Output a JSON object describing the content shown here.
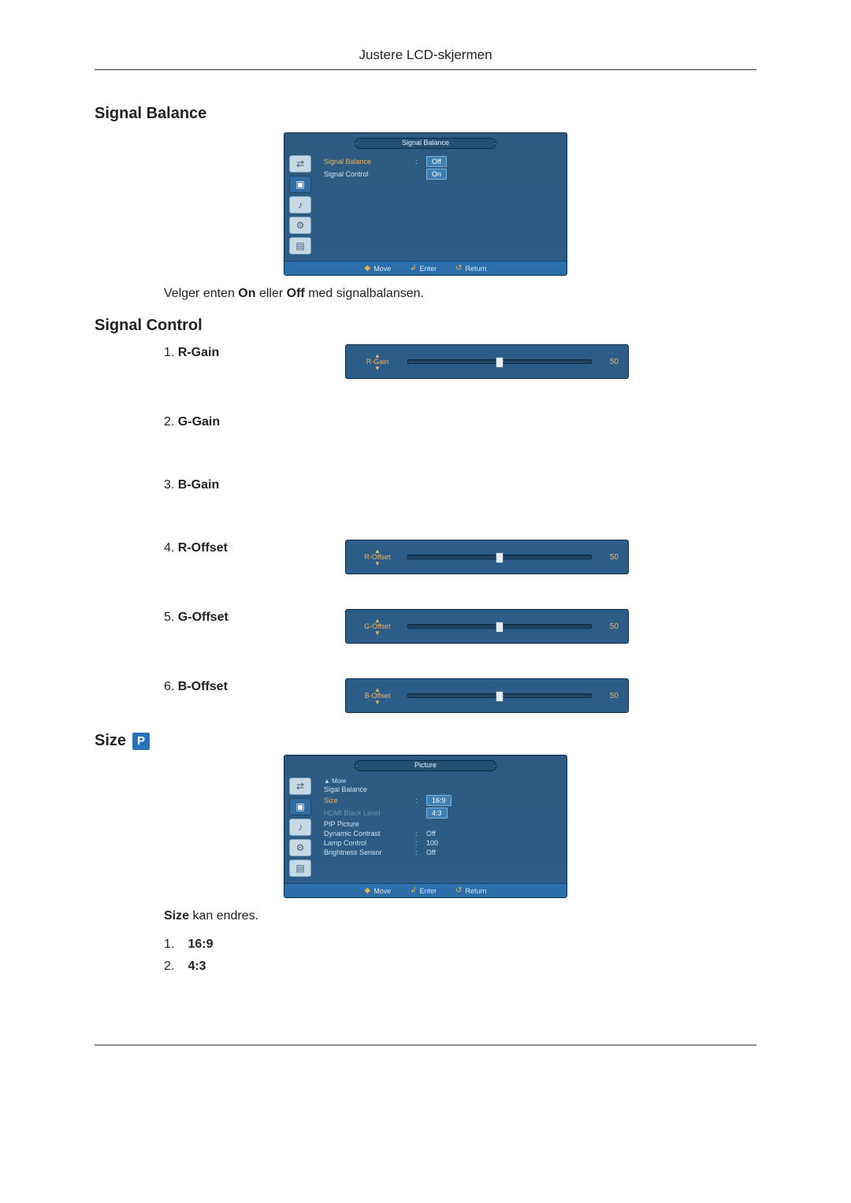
{
  "page_header": "Justere LCD-skjermen",
  "sections": {
    "signal_balance": {
      "heading": "Signal Balance",
      "body_pre": "Velger enten ",
      "body_on": "On",
      "body_mid": " eller ",
      "body_off": "Off",
      "body_post": " med signalbalansen.",
      "osd": {
        "title": "Signal Balance",
        "rows": [
          {
            "label": "Signal Balance",
            "value": "Off",
            "highlight": true,
            "orange": true
          },
          {
            "label": "Signal Control",
            "value": "On",
            "highlight": true
          }
        ],
        "footer": {
          "move": "Move",
          "enter": "Enter",
          "return": "Return"
        }
      }
    },
    "signal_control": {
      "heading": "Signal Control",
      "items": [
        {
          "num": "1.",
          "label": "R-Gain",
          "slider": {
            "name": "R-Gain",
            "value": 50
          }
        },
        {
          "num": "2.",
          "label": "G-Gain",
          "slider": null
        },
        {
          "num": "3.",
          "label": "B-Gain",
          "slider": null
        },
        {
          "num": "4.",
          "label": "R-Offset",
          "slider": {
            "name": "R-Offset",
            "value": 50
          }
        },
        {
          "num": "5.",
          "label": "G-Offset",
          "slider": {
            "name": "G-Offset",
            "value": 50
          }
        },
        {
          "num": "6.",
          "label": "B-Offset",
          "slider": {
            "name": "B-Offset",
            "value": 50
          }
        }
      ]
    },
    "size": {
      "heading": "Size",
      "badge": "P",
      "body_pre_bold": "Size",
      "body_post": " kan endres.",
      "options": [
        {
          "num": "1.",
          "label": "16:9"
        },
        {
          "num": "2.",
          "label": "4:3"
        }
      ],
      "osd": {
        "title": "Picture",
        "more": "▲ More",
        "rows": [
          {
            "label": "Sigal Balance",
            "value": ""
          },
          {
            "label": "Size",
            "value": "16:9",
            "highlight": true,
            "orange": true
          },
          {
            "label": "HDMI Black Level",
            "value": "4:3",
            "highlight": true,
            "muted": true
          },
          {
            "label": "PIP Picture",
            "value": ""
          },
          {
            "label": "Dynamic Contrast",
            "value": "Off"
          },
          {
            "label": "Lamp Control",
            "value": "100"
          },
          {
            "label": "Brightness Sensor",
            "value": "Off"
          }
        ],
        "footer": {
          "move": "Move",
          "enter": "Enter",
          "return": "Return"
        }
      }
    }
  },
  "icon_set": [
    "input-icon",
    "picture-icon",
    "sound-icon",
    "setup-icon",
    "multi-icon"
  ]
}
